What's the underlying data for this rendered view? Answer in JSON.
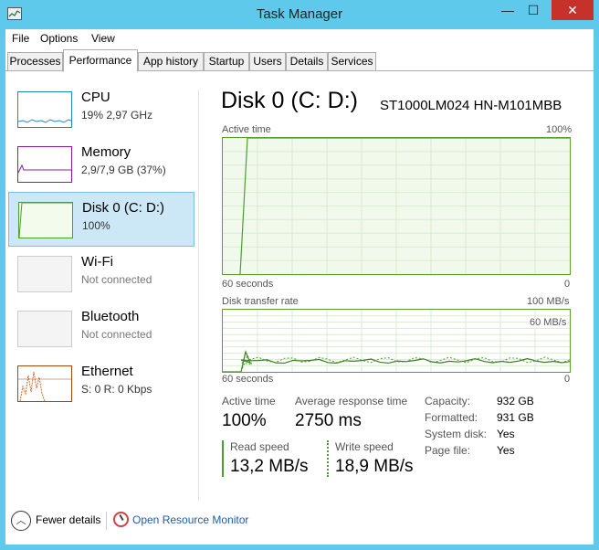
{
  "window": {
    "title": "Task Manager",
    "minimize": "—",
    "maximize": "☐",
    "close": "✕"
  },
  "menu": [
    "File",
    "Options",
    "View"
  ],
  "tabs": [
    "Processes",
    "Performance",
    "App history",
    "Startup",
    "Users",
    "Details",
    "Services"
  ],
  "active_tab": "Performance",
  "sidebar": {
    "items": [
      {
        "name": "CPU",
        "sub": "19% 2,97 GHz",
        "color": "#1f86c8"
      },
      {
        "name": "Memory",
        "sub": "2,9/7,9 GB (37%)",
        "color": "#8b1c9c"
      },
      {
        "name": "Disk 0 (C: D:)",
        "sub": "100%",
        "color": "#4aa02c"
      },
      {
        "name": "Wi-Fi",
        "sub": "Not connected",
        "color": "#999999"
      },
      {
        "name": "Bluetooth",
        "sub": "Not connected",
        "color": "#999999"
      },
      {
        "name": "Ethernet",
        "sub": "S: 0 R: 0 Kbps",
        "color": "#a6470b"
      }
    ],
    "selected": "Disk 0 (C: D:)"
  },
  "detail": {
    "title": "Disk 0 (C: D:)",
    "model": "ST1000LM024 HN-M101MBB",
    "active_graph": {
      "label": "Active time",
      "max": "100%",
      "time": "60 seconds",
      "min": "0"
    },
    "transfer_graph": {
      "label": "Disk transfer rate",
      "max": "100 MB/s",
      "mid": "60 MB/s",
      "time": "60 seconds",
      "min": "0"
    },
    "active_time_label": "Active time",
    "active_time_value": "100%",
    "avg_response_label": "Average response time",
    "avg_response_value": "2750 ms",
    "read_label": "Read speed",
    "read_value": "13,2 MB/s",
    "write_label": "Write speed",
    "write_value": "18,9 MB/s",
    "props": [
      {
        "label": "Capacity:",
        "value": "932 GB"
      },
      {
        "label": "Formatted:",
        "value": "931 GB"
      },
      {
        "label": "System disk:",
        "value": "Yes"
      },
      {
        "label": "Page file:",
        "value": "Yes"
      }
    ]
  },
  "footer": {
    "fewer_details": "Fewer details",
    "resource_monitor": "Open Resource Monitor"
  },
  "colors": {
    "accent": "#4aa02c",
    "selection": "#cce8f7",
    "title_bar": "#5ec9ea",
    "close": "#c7312c",
    "link": "#1a5dab"
  }
}
